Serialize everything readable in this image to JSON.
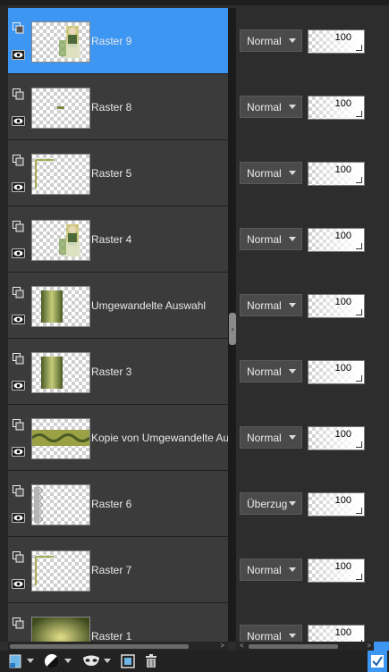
{
  "layers": [
    {
      "name": "Raster 9",
      "blend": "Normal",
      "opacity": "100",
      "selected": true,
      "thumb": "figure"
    },
    {
      "name": "Raster 8",
      "blend": "Normal",
      "opacity": "100",
      "selected": false,
      "thumb": "dot"
    },
    {
      "name": "Raster 5",
      "blend": "Normal",
      "opacity": "100",
      "selected": false,
      "thumb": "corner"
    },
    {
      "name": "Raster 4",
      "blend": "Normal",
      "opacity": "100",
      "selected": false,
      "thumb": "figure"
    },
    {
      "name": "Umgewandelte Auswahl",
      "blend": "Normal",
      "opacity": "100",
      "selected": false,
      "thumb": "green-bar"
    },
    {
      "name": "Raster 3",
      "blend": "Normal",
      "opacity": "100",
      "selected": false,
      "thumb": "green-bar"
    },
    {
      "name": "Kopie von Umgewandelte Auswahl",
      "blend": "Normal",
      "opacity": "100",
      "selected": false,
      "thumb": "band"
    },
    {
      "name": "Raster 6",
      "blend": "Überzug",
      "opacity": "100",
      "selected": false,
      "thumb": "edge"
    },
    {
      "name": "Raster 7",
      "blend": "Normal",
      "opacity": "100",
      "selected": false,
      "thumb": "corner"
    },
    {
      "name": "Raster 1",
      "blend": "Normal",
      "opacity": "100",
      "selected": false,
      "thumb": "gradient"
    }
  ],
  "icons": {
    "group": "layer-group-icon",
    "eye": "visibility-eye-icon"
  },
  "colors": {
    "selection": "#3d96f2",
    "row_bg": "#3b3b3b",
    "panel_bg": "#2d2d2d"
  }
}
